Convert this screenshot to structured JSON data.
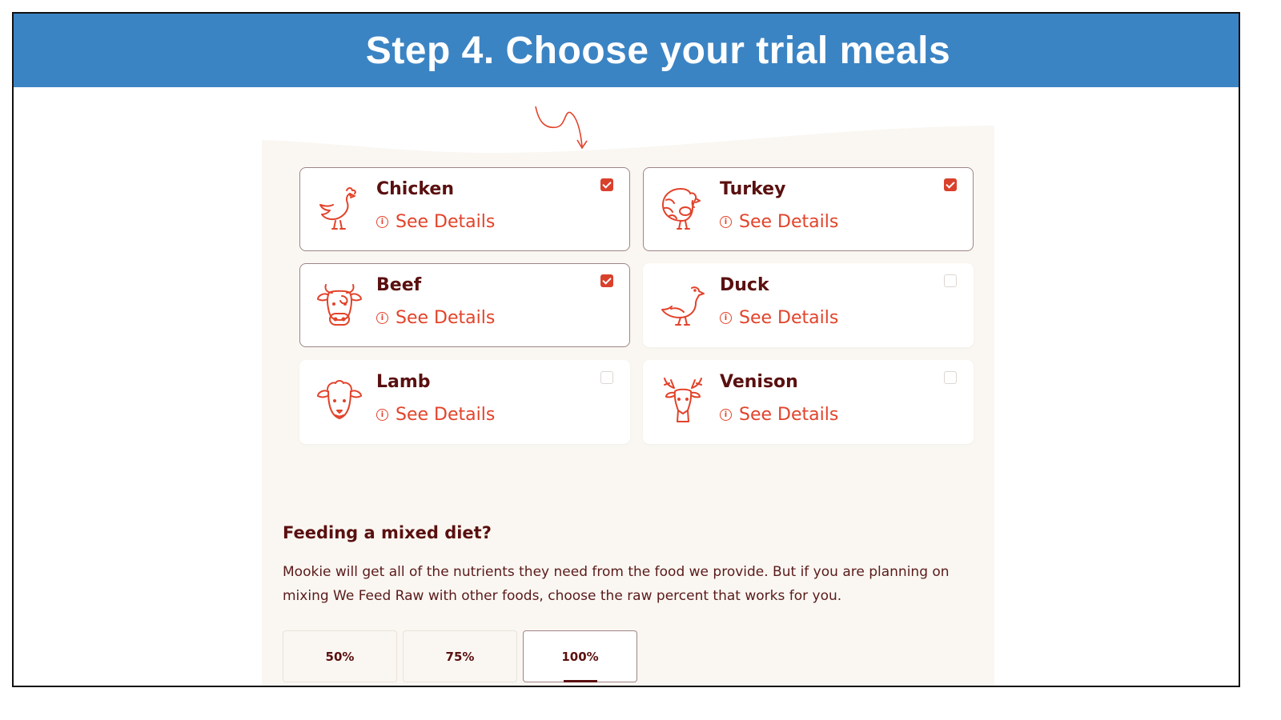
{
  "banner": {
    "title": "Step 4. Choose your trial meals"
  },
  "meals": [
    {
      "name": "Chicken",
      "details_label": "See Details",
      "selected": true,
      "icon": "chicken-icon"
    },
    {
      "name": "Turkey",
      "details_label": "See Details",
      "selected": true,
      "icon": "turkey-icon"
    },
    {
      "name": "Beef",
      "details_label": "See Details",
      "selected": true,
      "icon": "cow-icon"
    },
    {
      "name": "Duck",
      "details_label": "See Details",
      "selected": false,
      "icon": "duck-icon"
    },
    {
      "name": "Lamb",
      "details_label": "See Details",
      "selected": false,
      "icon": "sheep-icon"
    },
    {
      "name": "Venison",
      "details_label": "See Details",
      "selected": false,
      "icon": "deer-icon"
    }
  ],
  "info_glyph": "i",
  "mixed_diet": {
    "title": "Feeding a mixed diet?",
    "description": "Mookie will get all of the nutrients they need from the food we provide. But if you are planning on mixing We Feed Raw with other foods, choose the raw percent that works for you.",
    "options": [
      "50%",
      "75%",
      "100%"
    ],
    "selected": "100%"
  },
  "colors": {
    "banner": "#3b84c4",
    "accent": "#e2432a",
    "text_dark": "#5a1010",
    "panel_bg": "#faf7f2"
  }
}
